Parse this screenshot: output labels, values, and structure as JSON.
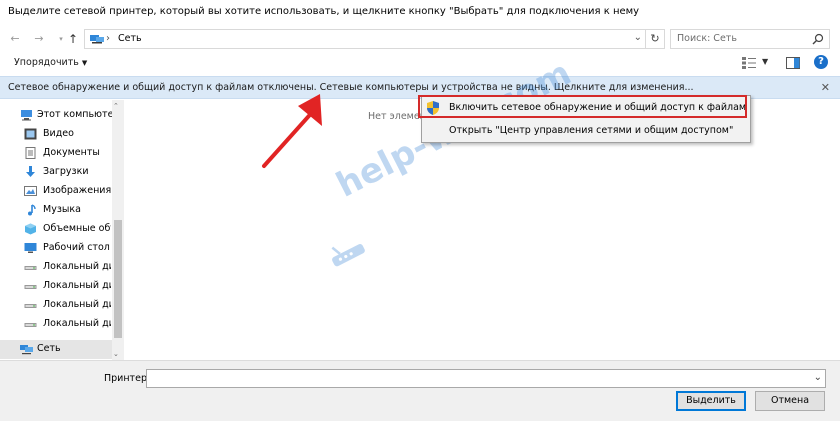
{
  "window": {
    "title": "Выделите сетевой принтер, который вы хотите использовать, и щелкните кнопку \"Выбрать\" для подключения к нему"
  },
  "address_bar": {
    "path": "Сеть",
    "search_placeholder": "Поиск: Сеть"
  },
  "toolbar": {
    "organize_label": "Упорядочить"
  },
  "info_bar": {
    "message": "Сетевое обнаружение и общий доступ к файлам отключены. Сетевые компьютеры и устройства не видны. Щелкните для изменения..."
  },
  "sidebar": {
    "items": [
      {
        "label": "Этот компьютер",
        "icon": "computer-icon"
      },
      {
        "label": "Видео",
        "icon": "video-icon"
      },
      {
        "label": "Документы",
        "icon": "documents-icon"
      },
      {
        "label": "Загрузки",
        "icon": "downloads-icon"
      },
      {
        "label": "Изображения",
        "icon": "pictures-icon"
      },
      {
        "label": "Музыка",
        "icon": "music-icon"
      },
      {
        "label": "Объемные объ",
        "icon": "3d-objects-icon"
      },
      {
        "label": "Рабочий стол",
        "icon": "desktop-icon"
      },
      {
        "label": "Локальный дис",
        "icon": "drive-icon"
      },
      {
        "label": "Локальный дис",
        "icon": "drive-icon"
      },
      {
        "label": "Локальный дис",
        "icon": "drive-icon"
      },
      {
        "label": "Локальный дис",
        "icon": "drive-icon"
      },
      {
        "label": "Сеть",
        "icon": "network-icon"
      }
    ]
  },
  "content": {
    "empty_text": "Нет элемен"
  },
  "context_menu": {
    "items": [
      {
        "label": "Включить сетевое обнаружение и общий доступ к файлам",
        "icon": "uac-shield-icon"
      },
      {
        "label": "Открыть \"Центр управления сетями и общим доступом\""
      }
    ]
  },
  "footer": {
    "printer_label": "Принтер",
    "printer_value": "",
    "select_button": "Выделить",
    "cancel_button": "Отмена"
  },
  "watermark": {
    "text": "help-wifi.com"
  },
  "colors": {
    "info_bar_bg": "#dbe9f7",
    "highlight_red": "#d42a2a",
    "accent_blue": "#0078d7"
  }
}
